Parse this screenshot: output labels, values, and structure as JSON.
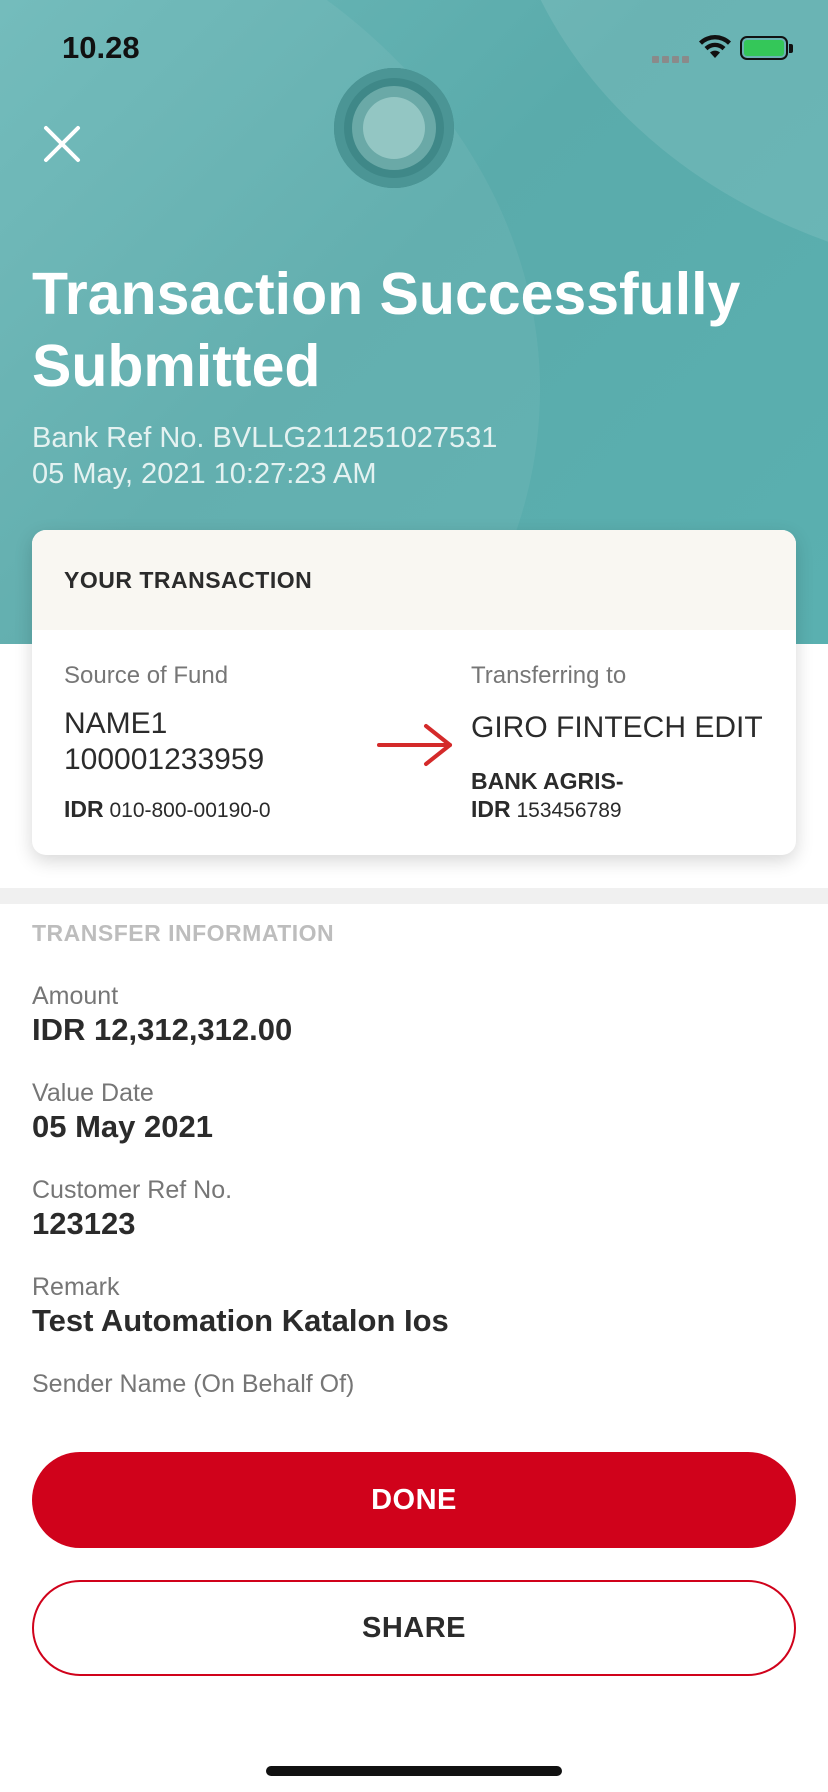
{
  "status_bar": {
    "time": "10.28"
  },
  "header": {
    "title": "Transaction Successfully Submitted",
    "bank_ref": "Bank Ref No. BVLLG211251027531",
    "datetime": "05 May, 2021 10:27:23 AM",
    "close_icon": "close-icon"
  },
  "transaction_card": {
    "heading": "YOUR TRANSACTION",
    "source": {
      "label": "Source of Fund",
      "name": "NAME1",
      "number": "100001233959",
      "currency": "IDR",
      "account": "010-800-00190-0"
    },
    "destination": {
      "label": "Transferring to",
      "name": "GIRO FINTECH EDIT",
      "bank": "BANK AGRIS-",
      "currency": "IDR",
      "account": "153456789"
    },
    "arrow_icon": "arrow-right-icon"
  },
  "transfer_info": {
    "heading": "TRANSFER INFORMATION",
    "amount_label": "Amount",
    "amount_value": "IDR 12,312,312.00",
    "value_date_label": "Value Date",
    "value_date_value": "05 May 2021",
    "customer_ref_label": "Customer Ref No.",
    "customer_ref_value": "123123",
    "remark_label": "Remark",
    "remark_value": "Test Automation Katalon Ios",
    "sender_label": "Sender Name (On Behalf Of)"
  },
  "buttons": {
    "done": "DONE",
    "share": "SHARE"
  },
  "colors": {
    "accent": "#d0021b",
    "hero": "#5aabab",
    "battery": "#34c759"
  }
}
